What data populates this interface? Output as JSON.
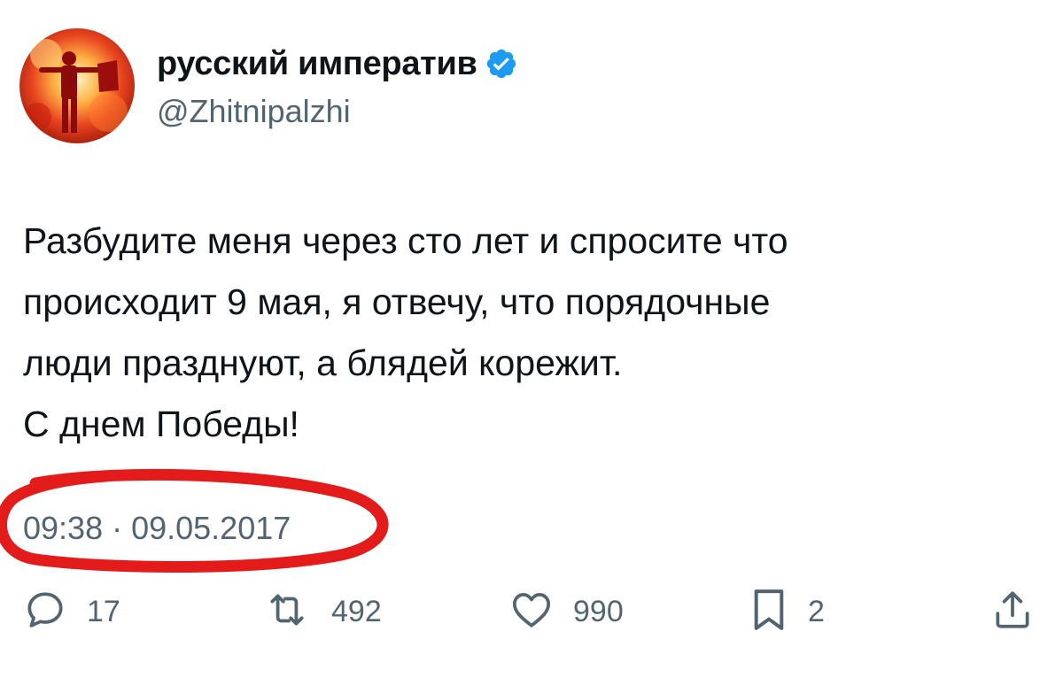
{
  "author": {
    "display_name": "русский императив",
    "handle": "@Zhitnipalzhi",
    "verified": true
  },
  "tweet": {
    "text": "Разбудите меня через сто лет и спросите что\nпроисходит 9 мая, я отвечу, что порядочные\nлюди празднуют, а блядей корежит.\nС днем Победы!",
    "timestamp": "09:38 · 09.05.2017"
  },
  "actions": {
    "replies": "17",
    "retweets": "492",
    "likes": "990",
    "bookmarks": "2"
  },
  "icons": {
    "reply": "reply-icon",
    "retweet": "retweet-icon",
    "like": "heart-icon",
    "bookmark": "bookmark-icon",
    "share": "share-icon",
    "verified": "verified-badge-icon"
  },
  "colors": {
    "text": "#0f1419",
    "secondary": "#536471",
    "verified": "#1d9bf0",
    "annotation": "#e31b1b"
  }
}
